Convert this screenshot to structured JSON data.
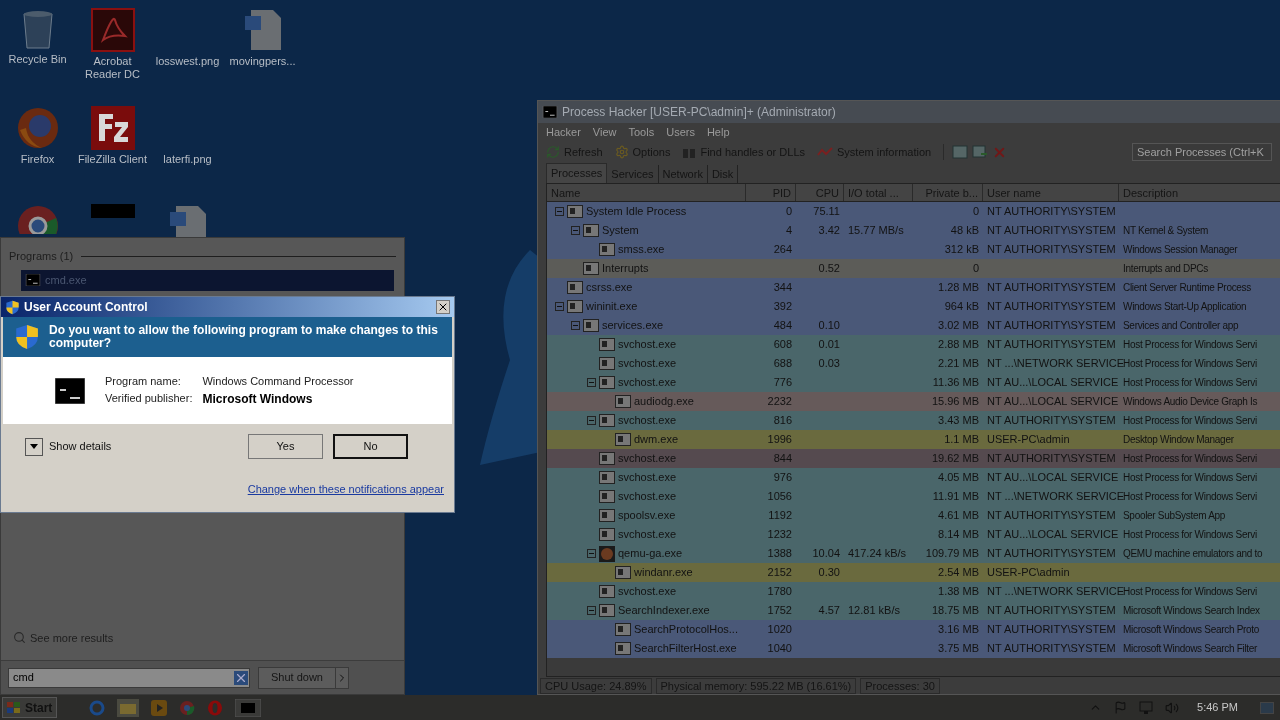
{
  "desktop_icons": [
    {
      "kind": "bin",
      "label": "Recycle Bin"
    },
    {
      "kind": "pdf",
      "label": "Acrobat Reader DC"
    },
    {
      "kind": "blank",
      "label": "losswest.png"
    },
    {
      "kind": "word",
      "label": "movingpers..."
    },
    {
      "kind": "firefox",
      "label": "Firefox"
    },
    {
      "kind": "filezilla",
      "label": "FileZilla Client"
    },
    {
      "kind": "blank",
      "label": "laterfi.png"
    },
    {
      "kind": "none"
    },
    {
      "kind": "chrome"
    },
    {
      "kind": "terminal"
    },
    {
      "kind": "word"
    }
  ],
  "start_menu": {
    "section": "Programs (1)",
    "results": [
      {
        "label": "cmd.exe",
        "selected": true
      }
    ],
    "more_results": "See more results",
    "search": {
      "value": "cmd"
    },
    "shutdown": "Shut down"
  },
  "uac": {
    "title": "User Account Control",
    "question": "Do you want to allow the following program to make changes to this computer?",
    "fields": [
      {
        "label": "Program name:",
        "value": "Windows Command Processor",
        "bold": false
      },
      {
        "label": "Verified publisher:",
        "value": "Microsoft Windows",
        "bold": true
      }
    ],
    "details": "Show details",
    "buttons": [
      {
        "label": "Yes",
        "default": false
      },
      {
        "label": "No",
        "default": true
      }
    ],
    "link": "Change when these notifications appear"
  },
  "process_hacker": {
    "title": "Process Hacker [USER-PC\\admin]+ (Administrator)",
    "menu": [
      "Hacker",
      "View",
      "Tools",
      "Users",
      "Help"
    ],
    "toolbar": [
      {
        "kind": "refresh",
        "label": "Refresh"
      },
      {
        "kind": "options",
        "label": "Options"
      },
      {
        "kind": "handles",
        "label": "Find handles or DLLs"
      },
      {
        "kind": "sysinfo",
        "label": "System information"
      }
    ],
    "search": {
      "placeholder": "Search Processes (Ctrl+K"
    },
    "tabs": [
      {
        "label": "Processes",
        "selected": true
      },
      {
        "label": "Services",
        "selected": false
      },
      {
        "label": "Network",
        "selected": false
      },
      {
        "label": "Disk",
        "selected": false
      }
    ],
    "columns": [
      "Name",
      "PID",
      "CPU",
      "I/O total ...",
      "Private b...",
      "User name",
      "Description"
    ],
    "processes": [
      {
        "name": "System Idle Process",
        "pid": "0",
        "cpu": "75.11",
        "private": "0",
        "user": "NT AUTHORITY\\SYSTEM",
        "color": "#4a5878",
        "expanded": true,
        "children": [
          {
            "name": "System",
            "pid": "4",
            "cpu": "3.42",
            "io": "15.77 MB/s",
            "private": "48 kB",
            "user": "NT AUTHORITY\\SYSTEM",
            "desc": "NT Kernel & System",
            "color": "#4a5878",
            "expanded": true,
            "children": [
              {
                "name": "smss.exe",
                "pid": "264",
                "private": "312 kB",
                "user": "NT AUTHORITY\\SYSTEM",
                "desc": "Windows Session Manager",
                "color": "#4a5878"
              }
            ]
          },
          {
            "name": "Interrupts",
            "cpu": "0.52",
            "private": "0",
            "desc": "Interrupts and DPCs",
            "color": "#5c5c58"
          }
        ]
      },
      {
        "name": "csrss.exe",
        "pid": "344",
        "private": "1.28 MB",
        "user": "NT AUTHORITY\\SYSTEM",
        "desc": "Client Server Runtime Process",
        "color": "#4a5878"
      },
      {
        "name": "wininit.exe",
        "pid": "392",
        "private": "964 kB",
        "user": "NT AUTHORITY\\SYSTEM",
        "desc": "Windows Start-Up Application",
        "color": "#4a5878",
        "expanded": true,
        "children": [
          {
            "name": "services.exe",
            "pid": "484",
            "cpu": "0.10",
            "private": "3.02 MB",
            "user": "NT AUTHORITY\\SYSTEM",
            "desc": "Services and Controller app",
            "color": "#4a5878",
            "expanded": true,
            "children": [
              {
                "name": "svchost.exe",
                "pid": "608",
                "cpu": "0.01",
                "private": "2.88 MB",
                "user": "NT AUTHORITY\\SYSTEM",
                "desc": "Host Process for Windows Servi",
                "color": "#4a666a"
              },
              {
                "name": "svchost.exe",
                "pid": "688",
                "cpu": "0.03",
                "private": "2.21 MB",
                "user": "NT ...\\NETWORK SERVICE",
                "desc": "Host Process for Windows Servi",
                "color": "#4a666a"
              },
              {
                "name": "svchost.exe",
                "pid": "776",
                "private": "11.36 MB",
                "user": "NT AU...\\LOCAL SERVICE",
                "desc": "Host Process for Windows Servi",
                "color": "#4a666a",
                "expanded": true,
                "children": [
                  {
                    "name": "audiodg.exe",
                    "pid": "2232",
                    "private": "15.96 MB",
                    "user": "NT AU...\\LOCAL SERVICE",
                    "desc": "Windows Audio Device Graph Is",
                    "color": "#665a5a"
                  }
                ]
              },
              {
                "name": "svchost.exe",
                "pid": "816",
                "private": "3.43 MB",
                "user": "NT AUTHORITY\\SYSTEM",
                "desc": "Host Process for Windows Servi",
                "color": "#4a666a",
                "expanded": true,
                "children": [
                  {
                    "name": "dwm.exe",
                    "pid": "1996",
                    "private": "1.1 MB",
                    "user": "USER-PC\\admin",
                    "desc": "Desktop Window Manager",
                    "color": "#6a6a3e"
                  }
                ]
              },
              {
                "name": "svchost.exe",
                "pid": "844",
                "private": "19.62 MB",
                "user": "NT AUTHORITY\\SYSTEM",
                "desc": "Host Process for Windows Servi",
                "color": "#554a4f"
              },
              {
                "name": "svchost.exe",
                "pid": "976",
                "private": "4.05 MB",
                "user": "NT AU...\\LOCAL SERVICE",
                "desc": "Host Process for Windows Servi",
                "color": "#4a666a"
              },
              {
                "name": "svchost.exe",
                "pid": "1056",
                "private": "11.91 MB",
                "user": "NT ...\\NETWORK SERVICE",
                "desc": "Host Process for Windows Servi",
                "color": "#4a666a"
              },
              {
                "name": "spoolsv.exe",
                "pid": "1192",
                "private": "4.61 MB",
                "user": "NT AUTHORITY\\SYSTEM",
                "desc": "Spooler SubSystem App",
                "color": "#4a666a"
              },
              {
                "name": "svchost.exe",
                "pid": "1232",
                "private": "8.14 MB",
                "user": "NT AU...\\LOCAL SERVICE",
                "desc": "Host Process for Windows Servi",
                "color": "#4a666a"
              },
              {
                "name": "qemu-ga.exe",
                "kind": "orb",
                "pid": "1388",
                "cpu": "10.04",
                "io": "417.24 kB/s",
                "private": "109.79 MB",
                "user": "NT AUTHORITY\\SYSTEM",
                "desc": "QEMU machine emulators and to",
                "color": "#4a666a",
                "expanded": true,
                "children": [
                  {
                    "name": "windanr.exe",
                    "pid": "2152",
                    "cpu": "0.30",
                    "private": "2.54 MB",
                    "user": "USER-PC\\admin",
                    "color": "#6a6a3e"
                  }
                ]
              },
              {
                "name": "svchost.exe",
                "pid": "1780",
                "private": "1.38 MB",
                "user": "NT ...\\NETWORK SERVICE",
                "desc": "Host Process for Windows Servi",
                "color": "#4a666a"
              },
              {
                "name": "SearchIndexer.exe",
                "pid": "1752",
                "cpu": "4.57",
                "io": "12.81 kB/s",
                "private": "18.75 MB",
                "user": "NT AUTHORITY\\SYSTEM",
                "desc": "Microsoft Windows Search Index",
                "color": "#4a666a",
                "expanded": true,
                "children": [
                  {
                    "name": "SearchProtocolHos...",
                    "pid": "1020",
                    "private": "3.16 MB",
                    "user": "NT AUTHORITY\\SYSTEM",
                    "desc": "Microsoft Windows Search Proto",
                    "color": "#4a5878"
                  },
                  {
                    "name": "SearchFilterHost.exe",
                    "pid": "1040",
                    "private": "3.75 MB",
                    "user": "NT AUTHORITY\\SYSTEM",
                    "desc": "Microsoft Windows Search Filter",
                    "color": "#4a5878"
                  }
                ]
              }
            ]
          }
        ]
      }
    ],
    "status": [
      "CPU Usage: 24.89%",
      "Physical memory: 595.22 MB (16.61%)",
      "Processes: 30"
    ]
  },
  "taskbar": {
    "start": "Start",
    "apps": [
      {
        "kind": "ie"
      },
      {
        "kind": "explorer"
      },
      {
        "kind": "media"
      },
      {
        "kind": "chrome"
      },
      {
        "kind": "opera"
      },
      {
        "kind": "terminal"
      }
    ],
    "clock": "5:46 PM"
  }
}
